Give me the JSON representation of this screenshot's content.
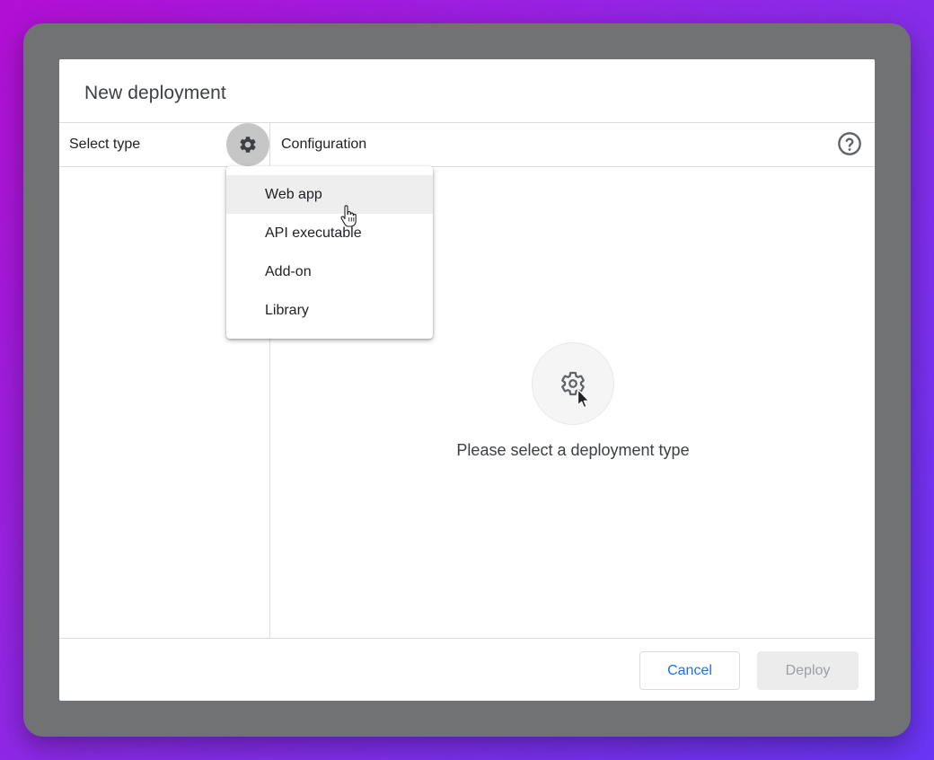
{
  "dialog": {
    "title": "New deployment"
  },
  "left_panel": {
    "header": "Select type",
    "gear_icon": "gear-icon"
  },
  "right_panel": {
    "header": "Configuration",
    "help_icon": "help-circle-icon",
    "empty_state": {
      "icon": "gear-icon",
      "message": "Please select a deployment type"
    }
  },
  "menu": {
    "items": [
      {
        "label": "Web app",
        "active": true
      },
      {
        "label": "API executable",
        "active": false
      },
      {
        "label": "Add-on",
        "active": false
      },
      {
        "label": "Library",
        "active": false
      }
    ]
  },
  "footer": {
    "cancel_label": "Cancel",
    "deploy_label": "Deploy"
  },
  "colors": {
    "accent": "#1a73e8",
    "frame": "#717273",
    "menu_hover": "#eeeeee",
    "disabled_bg": "#ececec",
    "disabled_text": "#9aa0a6"
  }
}
